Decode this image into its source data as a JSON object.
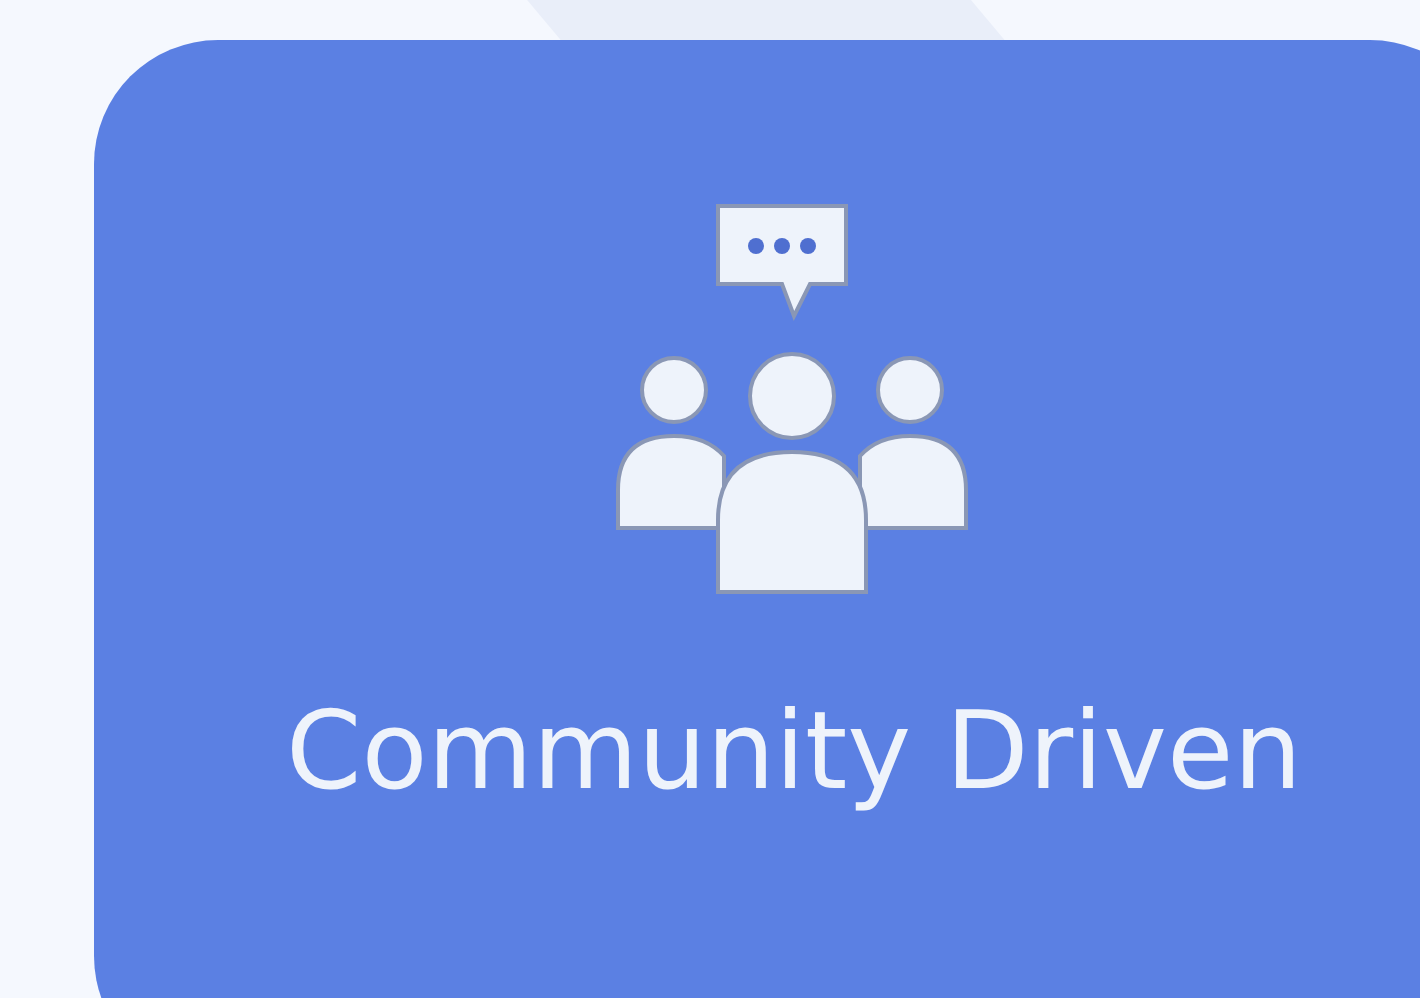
{
  "card": {
    "title": "Community Driven"
  }
}
